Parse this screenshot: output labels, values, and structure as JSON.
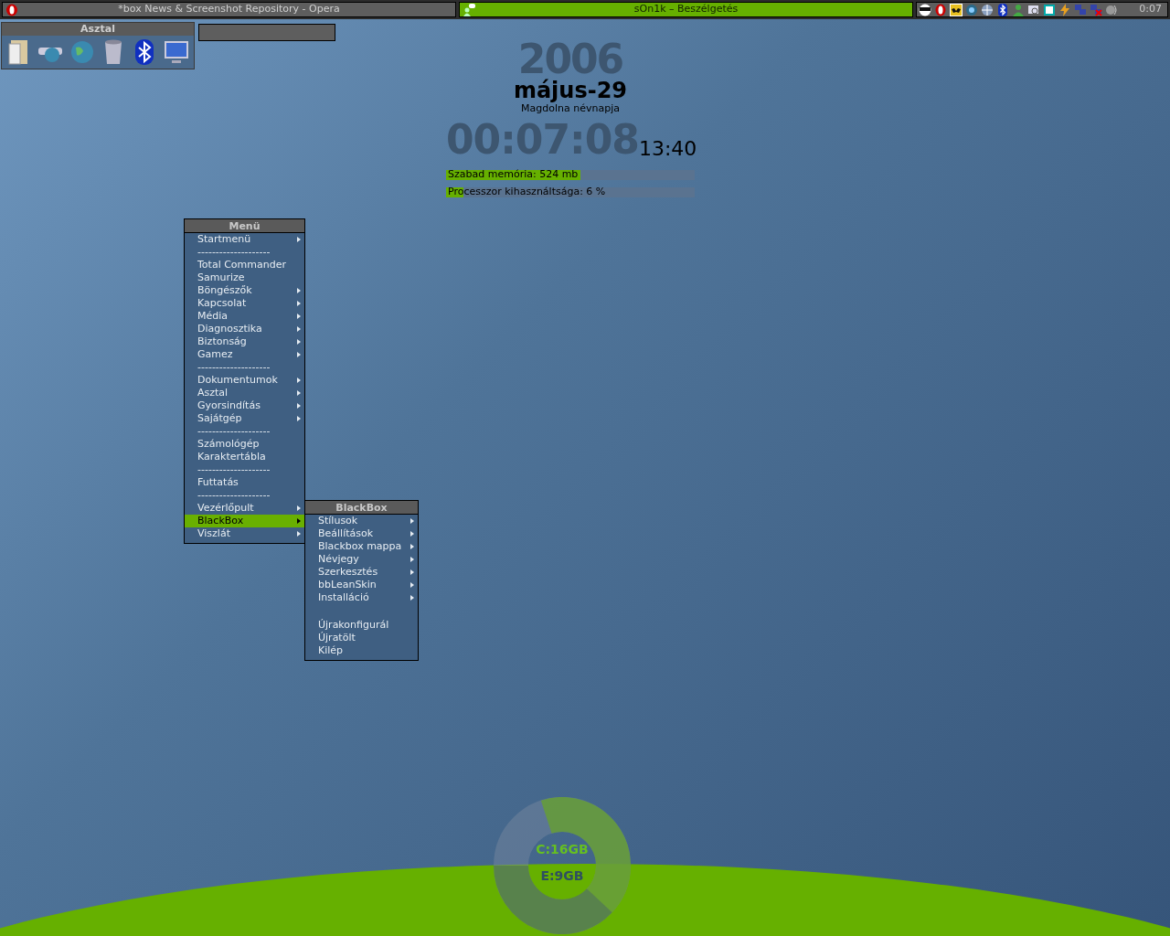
{
  "taskbar": {
    "tasks": [
      {
        "title": "*box News & Screenshot Repository - Opera",
        "selected": false
      },
      {
        "title": "sOn1k – Beszélgetés",
        "selected": true
      }
    ],
    "tray_icons": [
      {
        "kind": "mask"
      },
      {
        "kind": "opera"
      },
      {
        "kind": "bat"
      },
      {
        "kind": "network"
      },
      {
        "kind": "globe"
      },
      {
        "kind": "bluetooth"
      },
      {
        "kind": "person"
      },
      {
        "kind": "magnifier"
      },
      {
        "kind": "box"
      },
      {
        "kind": "lightning"
      },
      {
        "kind": "monitors"
      },
      {
        "kind": "monitors-x"
      },
      {
        "kind": "speaker"
      }
    ],
    "clock": "0:07"
  },
  "desktop_panel": {
    "title": "Asztal",
    "icons": [
      {
        "kind": "folder"
      },
      {
        "kind": "network"
      },
      {
        "kind": "globe"
      },
      {
        "kind": "bin"
      },
      {
        "kind": "bluetooth"
      },
      {
        "kind": "monitor"
      }
    ]
  },
  "widget": {
    "year": "2006",
    "date": "május-29",
    "nameday": "Magdolna névnapja",
    "uptime": "00:07:08",
    "time": "13:40",
    "meters": [
      {
        "label": "Szabad memória: 524 mb",
        "level": 0.54
      },
      {
        "label": "Processzor kihasználtsága: 6 %",
        "level": 0.07
      }
    ]
  },
  "menu": {
    "title": "Menü",
    "items": [
      {
        "kind": "item",
        "label": "Startmenü",
        "submenu": true,
        "selected": false
      },
      {
        "kind": "separator",
        "label": "--------------------"
      },
      {
        "kind": "item",
        "label": "Total Commander",
        "submenu": false,
        "selected": false
      },
      {
        "kind": "item",
        "label": "Samurize",
        "submenu": false,
        "selected": false
      },
      {
        "kind": "item",
        "label": "Böngészők",
        "submenu": true,
        "selected": false
      },
      {
        "kind": "item",
        "label": "Kapcsolat",
        "submenu": true,
        "selected": false
      },
      {
        "kind": "item",
        "label": "Média",
        "submenu": true,
        "selected": false
      },
      {
        "kind": "item",
        "label": "Diagnosztika",
        "submenu": true,
        "selected": false
      },
      {
        "kind": "item",
        "label": "Biztonság",
        "submenu": true,
        "selected": false
      },
      {
        "kind": "item",
        "label": "Gamez",
        "submenu": true,
        "selected": false
      },
      {
        "kind": "separator",
        "label": "--------------------"
      },
      {
        "kind": "item",
        "label": "Dokumentumok",
        "submenu": true,
        "selected": false
      },
      {
        "kind": "item",
        "label": "Asztal",
        "submenu": true,
        "selected": false
      },
      {
        "kind": "item",
        "label": "Gyorsindítás",
        "submenu": true,
        "selected": false
      },
      {
        "kind": "item",
        "label": "Sajátgép",
        "submenu": true,
        "selected": false
      },
      {
        "kind": "separator",
        "label": "--------------------"
      },
      {
        "kind": "item",
        "label": "Számológép",
        "submenu": false,
        "selected": false
      },
      {
        "kind": "item",
        "label": "Karaktertábla",
        "submenu": false,
        "selected": false
      },
      {
        "kind": "separator",
        "label": "--------------------"
      },
      {
        "kind": "item",
        "label": "Futtatás",
        "submenu": false,
        "selected": false
      },
      {
        "kind": "separator",
        "label": "--------------------"
      },
      {
        "kind": "item",
        "label": "Vezérlőpult",
        "submenu": true,
        "selected": false
      },
      {
        "kind": "item",
        "label": "BlackBox",
        "submenu": true,
        "selected": true
      },
      {
        "kind": "item",
        "label": "Viszlát",
        "submenu": true,
        "selected": false
      }
    ]
  },
  "submenu": {
    "title": "BlackBox",
    "items": [
      {
        "kind": "item",
        "label": "Stílusok",
        "submenu": true,
        "selected": false
      },
      {
        "kind": "item",
        "label": "Beállítások",
        "submenu": true,
        "selected": false
      },
      {
        "kind": "item",
        "label": "Blackbox mappa",
        "submenu": true,
        "selected": false
      },
      {
        "kind": "item",
        "label": "Névjegy",
        "submenu": true,
        "selected": false
      },
      {
        "kind": "item",
        "label": "Szerkesztés",
        "submenu": true,
        "selected": false
      },
      {
        "kind": "item",
        "label": "bbLeanSkin",
        "submenu": true,
        "selected": false
      },
      {
        "kind": "item",
        "label": "Installáció",
        "submenu": true,
        "selected": false
      },
      {
        "kind": "spacer"
      },
      {
        "kind": "item",
        "label": "Újrakonfigurál",
        "submenu": false,
        "selected": false
      },
      {
        "kind": "item",
        "label": "Újratölt",
        "submenu": false,
        "selected": false
      },
      {
        "kind": "item",
        "label": "Kilép",
        "submenu": false,
        "selected": false
      }
    ]
  },
  "drives": [
    {
      "label": "C:16GB"
    },
    {
      "label": "E:9GB"
    }
  ]
}
